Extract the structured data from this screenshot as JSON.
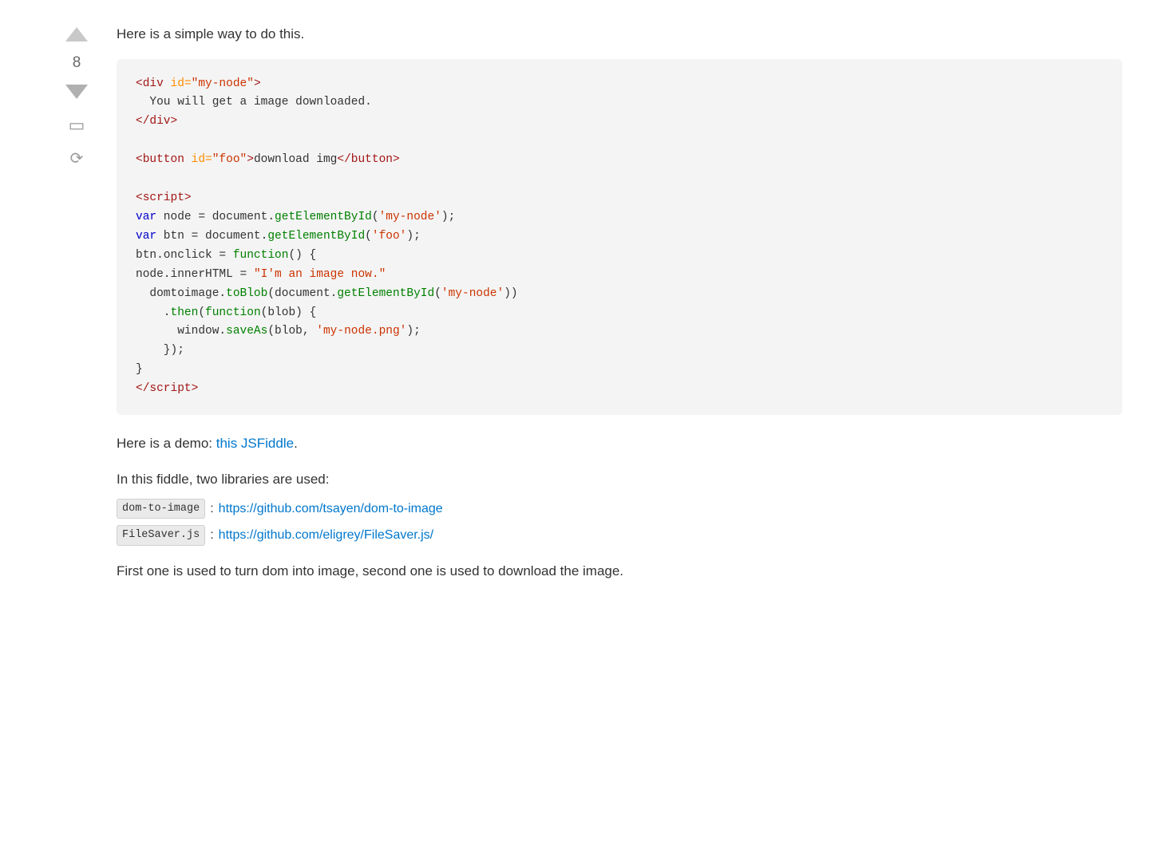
{
  "intro": "Here is a simple way to do this.",
  "vote": {
    "count": "8"
  },
  "code": {
    "html_section": "<div id=\"my-node\">\n  You will get a image downloaded.\n</div>\n\n<button id=\"foo\">download img</button>\n\n<script>\nvar node = document.getElementById('my-node');\nvar btn = document.getElementById('foo');\nbtn.onclick = function() {\nnode.innerHTML = \"I'm an image now.\"\n  domtoimage.toBlob(document.getElementById('my-node'))\n    .then(function(blob) {\n      window.saveAs(blob, 'my-node.png');\n    });\n}\n</script>"
  },
  "demo_text_before": "Here is a demo: ",
  "demo_link_text": "this JSFiddle",
  "demo_text_after": ".",
  "libraries_intro": "In this fiddle, two libraries are used:",
  "lib1": {
    "name": "dom-to-image",
    "separator": " : ",
    "url": "https://github.com/tsayen/dom-to-image"
  },
  "lib2": {
    "name": "FileSaver.js",
    "separator": " : ",
    "url": "https://github.com/eligrey/FileSaver.js/"
  },
  "summary": "First one is used to turn dom into image, second one is used to download the image."
}
